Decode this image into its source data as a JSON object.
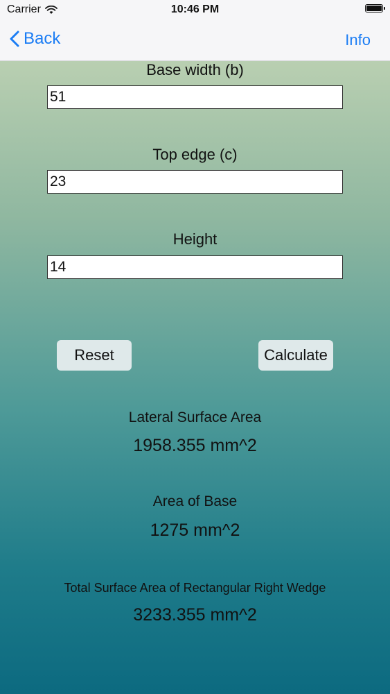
{
  "status_bar": {
    "carrier": "Carrier",
    "time": "10:46 PM"
  },
  "nav": {
    "back_label": "Back",
    "info_label": "Info"
  },
  "inputs": {
    "base_width": {
      "label": "Base width (b)",
      "value": "51"
    },
    "top_edge": {
      "label": "Top edge (c)",
      "value": "23"
    },
    "height": {
      "label": "Height",
      "value": "14"
    }
  },
  "buttons": {
    "reset_label": "Reset",
    "calculate_label": "Calculate"
  },
  "results": {
    "lateral": {
      "title": "Lateral Surface Area",
      "value": "1958.355 mm^2"
    },
    "base": {
      "title": "Area of Base",
      "value": "1275 mm^2"
    },
    "total": {
      "title": "Total Surface Area of Rectangular Right Wedge",
      "value": "3233.355 mm^2"
    }
  },
  "colors": {
    "accent": "#1a7cf4",
    "gradient_top": "#b9cfb1",
    "gradient_bottom": "#0c6a80",
    "button_bg": "#dfe9ea"
  }
}
